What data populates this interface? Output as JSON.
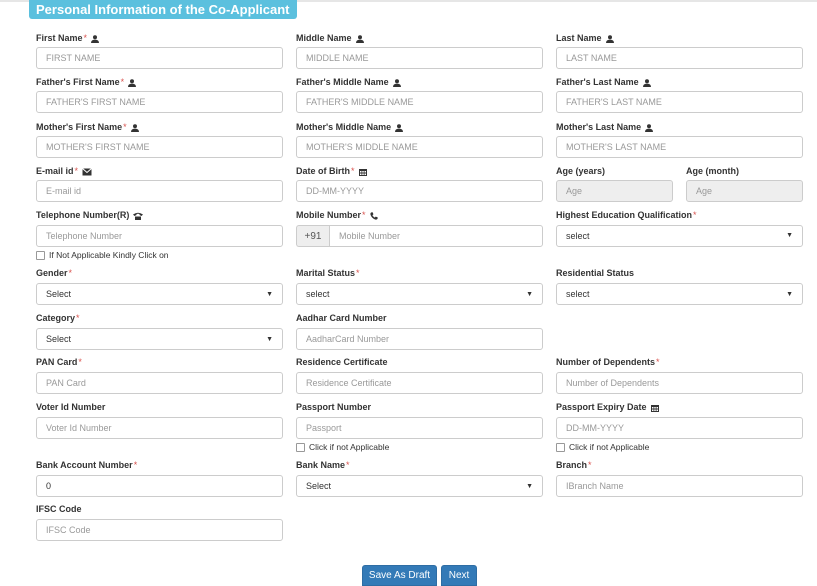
{
  "section_title": "Personal Information of the Co-Applicant",
  "required_mark": "*",
  "fields": {
    "first_name": {
      "label": "First Name",
      "placeholder": "FIRST NAME"
    },
    "middle_name": {
      "label": "Middle Name",
      "placeholder": "MIDDLE NAME"
    },
    "last_name": {
      "label": "Last Name",
      "placeholder": "LAST NAME"
    },
    "father_first": {
      "label": "Father's First Name",
      "placeholder": "FATHER'S FIRST NAME"
    },
    "father_middle": {
      "label": "Father's Middle Name",
      "placeholder": "FATHER'S MIDDLE NAME"
    },
    "father_last": {
      "label": "Father's Last Name",
      "placeholder": "FATHER'S LAST NAME"
    },
    "mother_first": {
      "label": "Mother's First Name",
      "placeholder": "MOTHER'S FIRST NAME"
    },
    "mother_middle": {
      "label": "Mother's Middle Name",
      "placeholder": "MOTHER'S MIDDLE NAME"
    },
    "mother_last": {
      "label": "Mother's Last Name",
      "placeholder": "MOTHER'S LAST NAME"
    },
    "email": {
      "label": "E-mail id",
      "placeholder": "E-mail id"
    },
    "dob": {
      "label": "Date of Birth",
      "placeholder": "DD-MM-YYYY"
    },
    "age_years": {
      "label": "Age (years)",
      "placeholder": "Age"
    },
    "age_month": {
      "label": "Age (month)",
      "placeholder": "Age"
    },
    "telephone": {
      "label": "Telephone Number(R)",
      "placeholder": "Telephone Number",
      "checkbox": "If Not Applicable Kindly Click on"
    },
    "mobile": {
      "label": "Mobile Number",
      "prefix": "+91",
      "placeholder": "Mobile Number"
    },
    "education": {
      "label": "Highest Education Qualification",
      "value": "select"
    },
    "gender": {
      "label": "Gender",
      "value": "Select"
    },
    "marital": {
      "label": "Marital Status",
      "value": "select"
    },
    "residential": {
      "label": "Residential Status",
      "value": "select"
    },
    "category": {
      "label": "Category",
      "value": "Select"
    },
    "aadhar": {
      "label": "Aadhar Card Number",
      "placeholder": "AadharCard Number"
    },
    "pan": {
      "label": "PAN Card",
      "placeholder": "PAN Card"
    },
    "residence_cert": {
      "label": "Residence Certificate",
      "placeholder": "Residence Certificate"
    },
    "dependents": {
      "label": "Number of Dependents",
      "placeholder": "Number of Dependents"
    },
    "voter": {
      "label": "Voter Id Number",
      "placeholder": "Voter Id Number"
    },
    "passport": {
      "label": "Passport Number",
      "placeholder": "Passport",
      "checkbox": "Click if not Applicable"
    },
    "passport_expiry": {
      "label": "Passport Expiry Date",
      "placeholder": "DD-MM-YYYY",
      "checkbox": "Click if not Applicable"
    },
    "bank_account": {
      "label": "Bank Account Number",
      "value": "0"
    },
    "bank_name": {
      "label": "Bank Name",
      "value": "Select"
    },
    "branch": {
      "label": "Branch",
      "placeholder": "IBranch Name"
    },
    "ifsc": {
      "label": "IFSC Code",
      "placeholder": "IFSC Code"
    }
  },
  "buttons": {
    "save_draft": "Save As Draft",
    "next": "Next"
  },
  "icons": {
    "person": "user-icon",
    "mail": "envelope-icon",
    "calendar": "calendar-icon",
    "phone": "phone-icon",
    "mobile": "handset-icon"
  },
  "colors": {
    "tab": "#5bc0de",
    "button": "#337ab7",
    "required": "#d9534f"
  }
}
